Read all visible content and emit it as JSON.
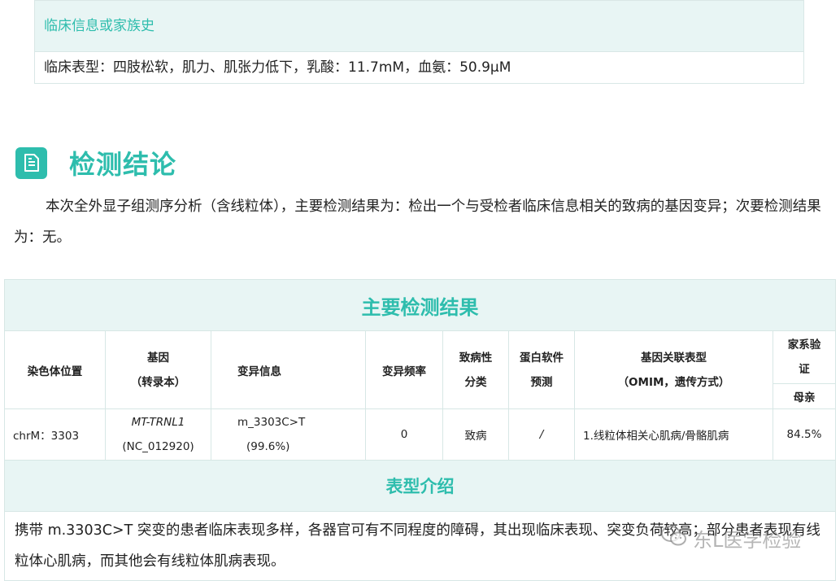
{
  "clinical": {
    "heading": "临床信息或家族史",
    "text": "临床表型：四肢松软，肌力、肌张力低下，乳酸：11.7mM，血氨：50.9μM"
  },
  "section": {
    "icon": "document-icon",
    "title": "检测结论",
    "conclusion": "本次全外显子组测序分析（含线粒体），主要检测结果为：检出一个与受检者临床信息相关的致病的基因变异；次要检测结果为：无。"
  },
  "table": {
    "title": "主要检测结果",
    "headers": {
      "chrom": "染色体位置",
      "gene_line1": "基因",
      "gene_line2": "（转录本）",
      "variant": "变异信息",
      "freq": "变异频率",
      "path_line1": "致病性",
      "path_line2": "分类",
      "pred_line1": "蛋白软件",
      "pred_line2": "预测",
      "pheno_line1": "基因关联表型",
      "pheno_line2": "（OMIM，遗传方式）",
      "family_line1": "家系验",
      "family_line2": "证",
      "family_sub": "母亲"
    },
    "row": {
      "chrom": "chrM：3303",
      "gene": "MT-TRNL1",
      "transcript": "(NC_012920)",
      "variant": "m_3303C>T",
      "variant_ratio": "(99.6%)",
      "freq": "0",
      "path": "致病",
      "pred": "/",
      "pheno": "1.线粒体相关心肌病/骨骼肌病",
      "mother": "84.5%"
    },
    "phenotype_title": "表型介绍",
    "phenotype_text": "携带 m.3303C>T 突变的患者临床表现多样，各器官可有不同程度的障碍，其出现临床表现、突变负荷较高；部分患者表现有线粒体心肌病，而其他会有线粒体肌病表现。"
  },
  "watermark": {
    "icon": "wechat-icon",
    "text": "东L医学检验"
  }
}
